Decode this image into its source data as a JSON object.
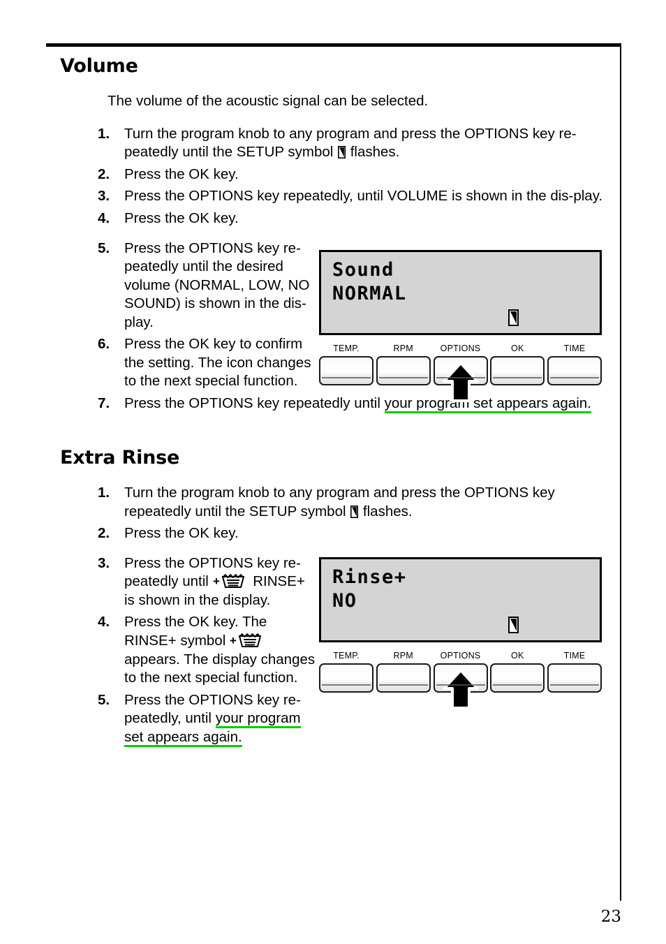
{
  "page": {
    "number": "23"
  },
  "sections": [
    {
      "id": "volume",
      "title": "Volume",
      "intro": "The volume of the acoustic signal can be selected.",
      "steps": [
        {
          "num": "1.",
          "text_a": "Turn the program knob to any program and press the OPTIONS key re-peatedly until the SETUP symbol ",
          "icon": "setup-symbol",
          "text_b": " flashes."
        },
        {
          "num": "2.",
          "text_a": "Press the OK key."
        },
        {
          "num": "3.",
          "text_a": "Press the OPTIONS key repeatedly, until VOLUME is shown in the dis-play."
        },
        {
          "num": "4.",
          "text_a": "Press the OK key."
        },
        {
          "num": "5.",
          "text_a": "Press the OPTIONS key re-peatedly until the desired volume (NORMAL, LOW, NO SOUND) is shown in the dis-play."
        },
        {
          "num": "6.",
          "text_a": "Press the OK key to confirm the setting. The icon changes to the next special function."
        },
        {
          "num": "7.",
          "text_a": "Press the OPTIONS key repeatedly until ",
          "link": "your program set appears again."
        }
      ],
      "figure": {
        "lcd": {
          "line1": "Sound",
          "line2": "NORMAL",
          "icon": "setup-symbol"
        },
        "keys": [
          {
            "label": "TEMP.",
            "pressed": false
          },
          {
            "label": "RPM",
            "pressed": false
          },
          {
            "label": "OPTIONS",
            "pressed": true
          },
          {
            "label": "OK",
            "pressed": false
          },
          {
            "label": "TIME",
            "pressed": false
          }
        ],
        "arrow_icon": "up-arrow-icon"
      }
    },
    {
      "id": "extra-rinse",
      "title": "Extra Rinse",
      "steps": [
        {
          "num": "1.",
          "text_a": "Turn the program knob to any program and press the OPTIONS key repeatedly until the SETUP symbol ",
          "icon": "setup-symbol",
          "text_b": " flashes."
        },
        {
          "num": "2.",
          "text_a": "Press the OK key."
        },
        {
          "num": "3.",
          "text_a": "Press the OPTIONS key re-peatedly until ",
          "icon": "rinse-plus-symbol",
          "text_b": " RINSE+ is shown in the display."
        },
        {
          "num": "4.",
          "text_a": "Press the OK key. The RINSE+ symbol ",
          "icon": "rinse-plus-symbol",
          "text_b": " appears. The display changes to the next special function."
        },
        {
          "num": "5.",
          "text_a": "Press the OPTIONS key re-peatedly, until ",
          "link": "your program set appears again."
        }
      ],
      "figure": {
        "lcd": {
          "line1": "Rinse+",
          "line2": "NO",
          "icon": "setup-symbol"
        },
        "keys": [
          {
            "label": "TEMP.",
            "pressed": false
          },
          {
            "label": "RPM",
            "pressed": false
          },
          {
            "label": "OPTIONS",
            "pressed": true
          },
          {
            "label": "OK",
            "pressed": false
          },
          {
            "label": "TIME",
            "pressed": false
          }
        ],
        "arrow_icon": "up-arrow-icon"
      }
    }
  ],
  "colors": {
    "link_underline": "#00cc00",
    "lcd_background": "#d4d4d4",
    "ink": "#000000"
  }
}
